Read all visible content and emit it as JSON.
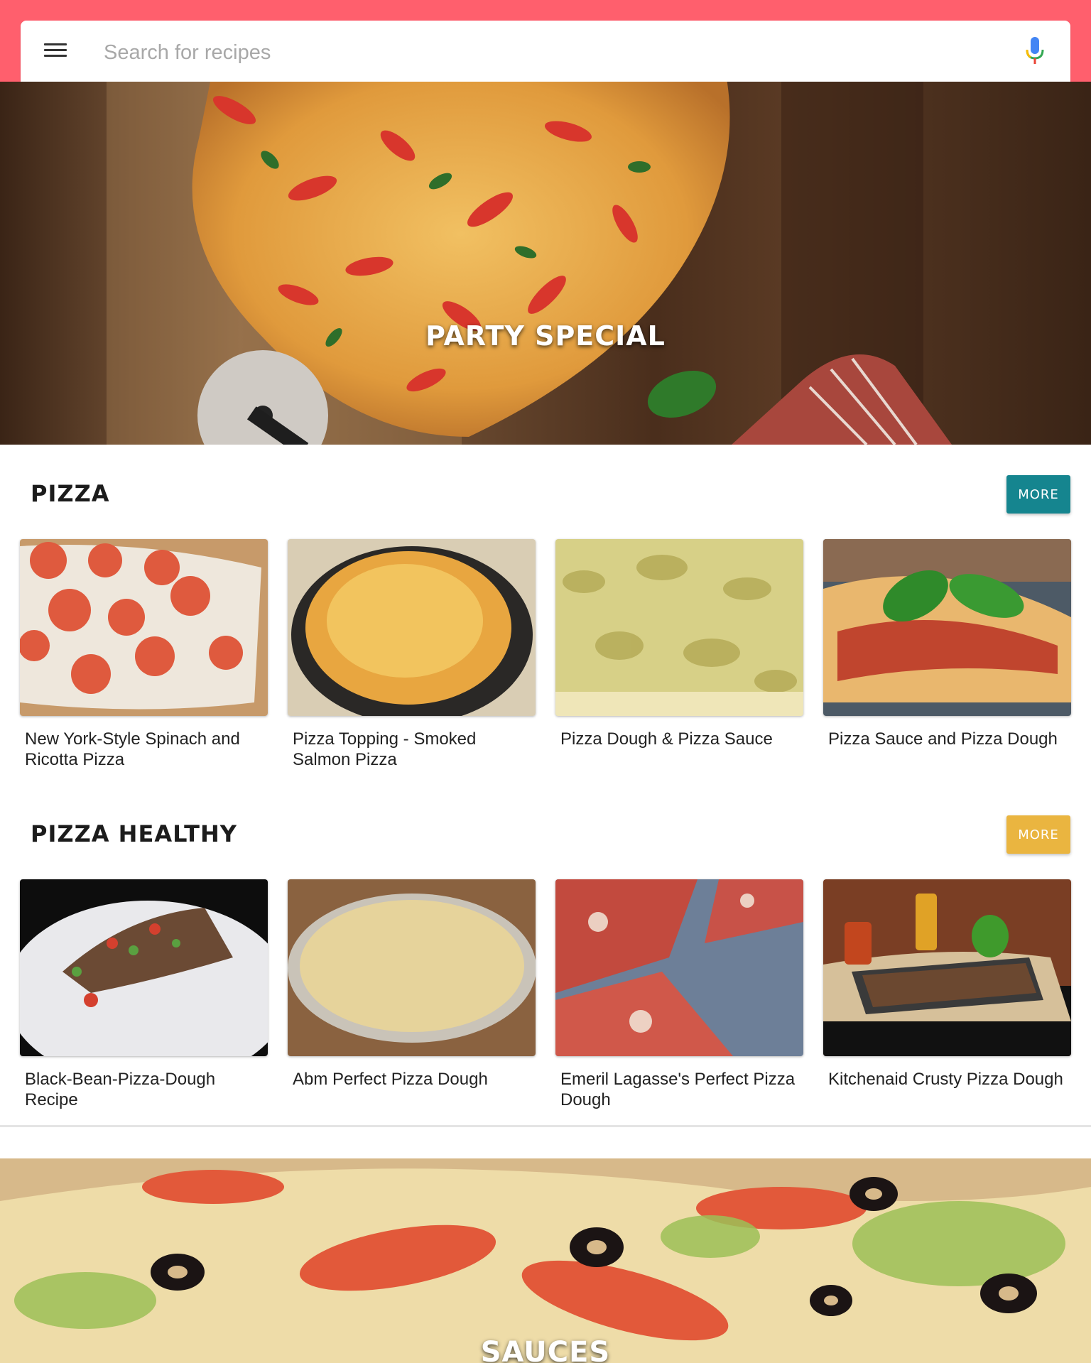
{
  "search": {
    "placeholder": "Search for recipes"
  },
  "icons": {
    "menu": "hamburger-menu-icon",
    "mic": "microphone-icon"
  },
  "colors": {
    "top_bar": "#ff5f6d",
    "pizza_more": "#15858f",
    "healthy_more": "#eab540"
  },
  "hero": {
    "title": "PARTY SPECIAL"
  },
  "sections": {
    "pizza": {
      "title": "PIZZA",
      "more_label": "MORE",
      "cards": [
        {
          "title": "New York-Style Spinach and Ricotta Pizza"
        },
        {
          "title": "Pizza Topping - Smoked Salmon Pizza"
        },
        {
          "title": "Pizza Dough & Pizza Sauce"
        },
        {
          "title": "Pizza Sauce and Pizza Dough"
        }
      ]
    },
    "healthy": {
      "title": "PIZZA HEALTHY",
      "more_label": "MORE",
      "cards": [
        {
          "title": "Black-Bean-Pizza-Dough Recipe"
        },
        {
          "title": "Abm Perfect Pizza Dough"
        },
        {
          "title": "Emeril Lagasse's Perfect Pizza Dough"
        },
        {
          "title": "Kitchenaid Crusty Pizza Dough"
        }
      ]
    }
  },
  "sauces": {
    "title": "SAUCES"
  }
}
